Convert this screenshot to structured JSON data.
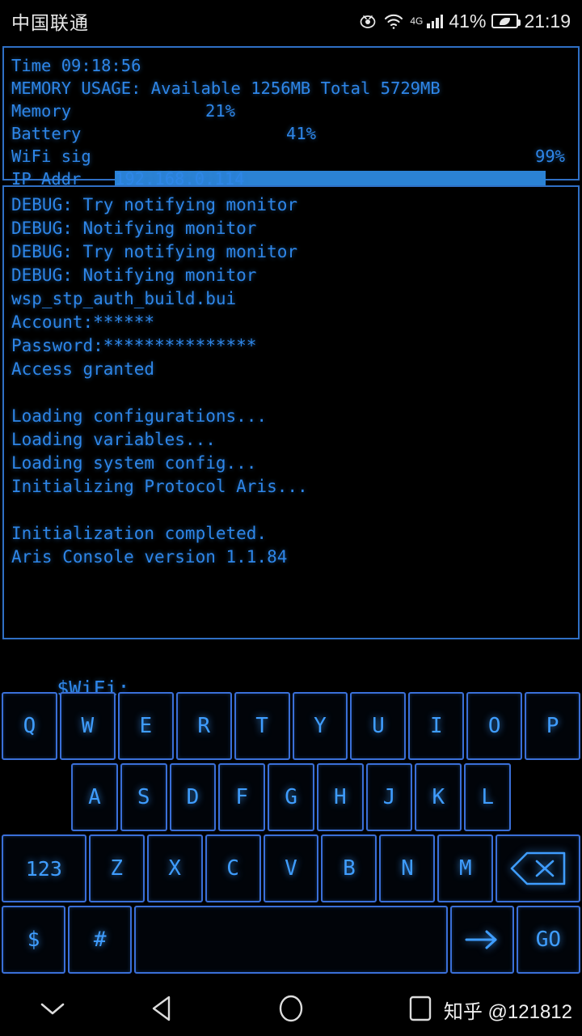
{
  "statusbar": {
    "carrier": "中国联通",
    "network_label": "4G",
    "battery_percent": "41%",
    "clock": "21:19",
    "icons": [
      "eye-care-icon",
      "wifi-icon",
      "signal-bars-icon",
      "battery-saver-icon"
    ]
  },
  "system_panel": {
    "time_line": "Time 09:18:56",
    "memory_line": "MEMORY USAGE: Available 1256MB Total 5729MB",
    "stats": [
      {
        "label": "Memory",
        "percent": 21,
        "percent_label": "21%"
      },
      {
        "label": "Battery",
        "percent": 41,
        "percent_label": "41%"
      },
      {
        "label": "WiFi sig",
        "percent": 99,
        "percent_label": "99%"
      }
    ],
    "ip_label": "IP Addr",
    "ip_value": "192.168.0.114",
    "border_color": "#2f6fc4",
    "bar_color": "#2b82d4"
  },
  "console": {
    "lines": [
      "DEBUG: Try notifying monitor",
      "DEBUG: Notifying monitor",
      "DEBUG: Try notifying monitor",
      "DEBUG: Notifying monitor",
      "wsp_stp_auth_build.bui",
      "Account:******",
      "Password:***************",
      "Access granted",
      "",
      "Loading configurations...",
      "Loading variables...",
      "Loading system config...",
      "Initializing Protocol Aris...",
      "",
      "Initialization completed.",
      "Aris Console version 1.1.84"
    ],
    "text_color": "#2e86e8"
  },
  "prompt": {
    "text": "$WiFi:",
    "value": ""
  },
  "keyboard": {
    "row1": [
      "Q",
      "W",
      "E",
      "R",
      "T",
      "Y",
      "U",
      "I",
      "O",
      "P"
    ],
    "row2": [
      "A",
      "S",
      "D",
      "F",
      "G",
      "H",
      "J",
      "K",
      "L"
    ],
    "row3_numeric": "123",
    "row3": [
      "Z",
      "X",
      "C",
      "V",
      "B",
      "N",
      "M"
    ],
    "backspace": "backspace-icon",
    "row4": {
      "dollar": "$",
      "hash": "#",
      "space": "",
      "arrow": "arrow-right-icon",
      "go": "GO"
    },
    "key_color": "#3f9dff",
    "key_border": "#3a6fd8"
  },
  "navbar": {
    "hide_keyboard": "chevron-down-icon",
    "back": "back-triangle-icon",
    "home": "home-circle-icon",
    "recents": "recents-square-icon",
    "watermark": "知乎 @121812"
  }
}
